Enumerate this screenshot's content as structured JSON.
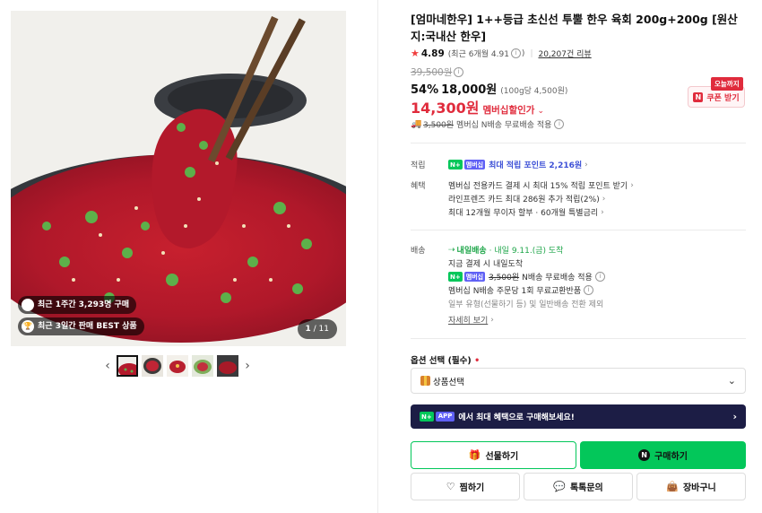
{
  "gallery": {
    "badge_week": "최근 1주간 3,293명 구매",
    "badge_best": "최근 3일간 판매 BEST 상품",
    "counter_current": "1",
    "counter_total": "/ 11",
    "prev_arrow": "‹",
    "next_arrow": "›",
    "thumb_count": 5
  },
  "product": {
    "title": "[엄마네한우] 1++등급 초신선 투뿔 한우 육회 200g+200g [원산지:국내산 한우]",
    "rating_score": "4.89",
    "rating_recent": "(최근 6개월 4.91",
    "review_count": "20,207건 리뷰",
    "original_price": "39,500원",
    "discount_pct": "54%",
    "sale_price": "18,000원",
    "unit_price": "(100g당 4,500원)",
    "member_price": "14,300원",
    "member_label": "멤버십할인가",
    "coupon_tag": "오늘까지",
    "coupon_label": "쿠폰 받기",
    "shipping_strike": "3,500원",
    "shipping_text": "멤버십 N배송 무료배송 적용"
  },
  "points": {
    "label": "적립",
    "npay": "N+",
    "membership_badge": "멤버십",
    "text": "최대 적립 포인트 2,216원"
  },
  "benefits": {
    "label": "혜택",
    "lines": [
      "멤버십 전용카드 결제 시 최대 15% 적립 포인트 받기",
      "라인프렌즈 카드 최대 286원 추가 적립(2%)",
      "최대 12개월 무이자 할부 · 60개월 특별금리"
    ]
  },
  "delivery": {
    "label": "배송",
    "arrival_tag": "내일배송",
    "arrival_text": "· 내일 9.11.(금) 도착",
    "order_note": "지금 결제 시 내일도착",
    "free_strike": "3,500원",
    "free_text": "N배송 무료배송 적용",
    "exchange": "멤버십 N배송 주문당 1회 무료교환반품",
    "exclude": "일부 유형(선물하기 등) 및 일반배송 전환 제외",
    "more": "자세히 보기"
  },
  "options": {
    "label": "옵션 선택 (필수)",
    "required_mark": "•",
    "select_value": "상품선택"
  },
  "promo": {
    "app_badge": "APP",
    "text": "에서 최대 혜택으로 구매해보세요!"
  },
  "buttons": {
    "gift": "선물하기",
    "buy": "구매하기",
    "wish": "찜하기",
    "talk": "톡톡문의",
    "cart": "장바구니"
  },
  "colors": {
    "accent_red": "#e02b3c",
    "naver_green": "#03c75a",
    "promo_navy": "#1c1d45",
    "link_blue": "#3d50d6"
  }
}
